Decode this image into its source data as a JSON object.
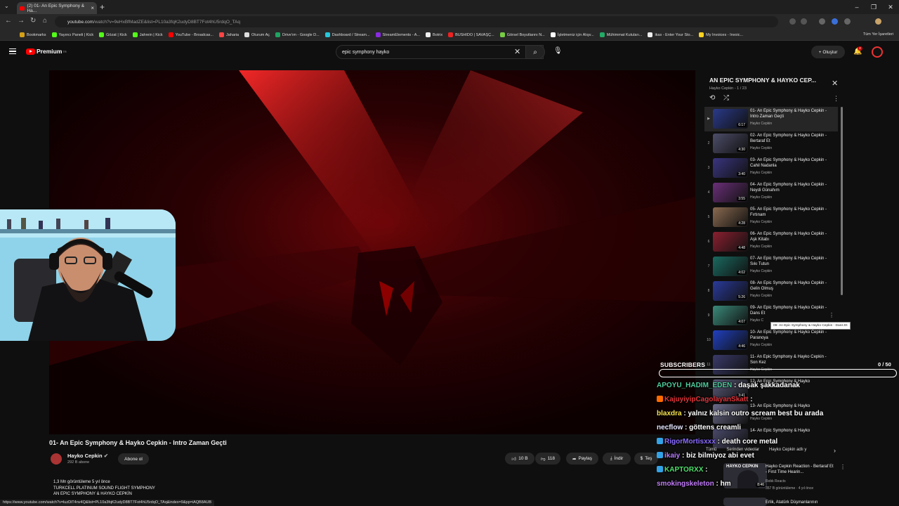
{
  "browser": {
    "tab_title": "(2) 01- An Epic Symphony & Ha...",
    "new_tab": "+",
    "url": "youtube.com",
    "url_rest": "/watch?v=9eHxBfMadZE&list=PL10a3fqK2udyD8BT7Fot4hU5rdqO_TAq",
    "bookmarks": [
      "Bookmarks",
      "Yayıncı Paneli | Kick",
      "Gözat | Kick",
      "Jahrein | Kick",
      "YouTube - Broadcas...",
      "Jaharia",
      "Oturum Aç",
      "Drive'ım - Google D...",
      "Dashboard / Stream...",
      "StreamElements - A...",
      "Botrix",
      "BUSHIDO | SAVAŞÇ...",
      "Görsel Boyutlarını N...",
      "İşletmeniz için Alışv...",
      "Mühimmat Kutuları...",
      "ikas - Enter Your Sto...",
      "My Invoices - Invoic..."
    ],
    "all_bookmarks": "Tüm Yer İşaretleri",
    "status_url": "https://www.youtube.com/watch?v=luzDiT4nv4Q&list=PL10a3fqK2udyD8BT7Fot4hU5rdqO_TAq&index=9&pp=iAQB8AUB"
  },
  "youtube": {
    "logo": "Premium",
    "logo_region": "TR",
    "search_value": "epic symphony hayko",
    "create_label": "Oluştur",
    "notif_count": "2"
  },
  "video": {
    "title": "01- An Epic Symphony & Hayko Cepkin - Intro Zaman Geçti",
    "channel": "Hayko Cepkin",
    "subscribers": "292 B abone",
    "subscribe_label": "Abone ol",
    "likes": "10 B",
    "comments": "118",
    "share": "Paylaş",
    "download": "İndir",
    "thanks": "Teş",
    "views_line": "1,3 Mn görüntüleme  5 yıl önce",
    "desc1": "TURKCELL PLATINUM SOUND FLIGHT SYMPHONY",
    "desc2": "AN EPIC SYMPHONY & HAYKO CEPKİN"
  },
  "playlist": {
    "title": "AN EPIC SYMPHONY & HAYKO CEP...",
    "sub": "Hayko Cepkin - 1 / 23",
    "tooltip": "09- An Epic Symphony & Hayko Cepkin - Dans Et",
    "items": [
      {
        "num": "▶",
        "title": "01- An Epic Symphony & Hayko Cepkin - Intro Zaman Geçti",
        "channel": "Hayko Cepkin",
        "duration": "6:17"
      },
      {
        "num": "2",
        "title": "02- An Epic Symphony & Hayko Cepkin - Bertaraf Et",
        "channel": "Hayko Cepkin",
        "duration": "4:30"
      },
      {
        "num": "3",
        "title": "03- An Epic Symphony & Hayko Cepkin - Cahil Nadanla",
        "channel": "Hayko Cepkin",
        "duration": "3:40"
      },
      {
        "num": "4",
        "title": "04- An Epic Symphony & Hayko Cepkin - Neydi Günahım",
        "channel": "Hayko Cepkin",
        "duration": "3:55"
      },
      {
        "num": "5",
        "title": "05- An Epic Symphony & Hayko Cepkin - Fırtınam",
        "channel": "Hayko Cepkin",
        "duration": "4:28"
      },
      {
        "num": "6",
        "title": "06- An Epic Symphony & Hayko Cepkin - Aşk Kitabı",
        "channel": "Hayko Cepkin",
        "duration": "4:48"
      },
      {
        "num": "7",
        "title": "07- An Epic Symphony & Hayko Cepkin - Sıkı Tutun",
        "channel": "Hayko Cepkin",
        "duration": "4:02"
      },
      {
        "num": "8",
        "title": "08- An Epic Symphony & Hayko Cepkin - Gelin Olmuş",
        "channel": "Hayko Cepkin",
        "duration": "5:26"
      },
      {
        "num": "9",
        "title": "09- An Epic Symphony & Hayko Cepkin - Dans Et",
        "channel": "Hayko C",
        "duration": "4:07"
      },
      {
        "num": "10",
        "title": "10- An Epic Symphony & Hayko Cepkin - Paranoya",
        "channel": "Hayko Cepkin",
        "duration": "4:46"
      },
      {
        "num": "11",
        "title": "11- An Epic Symphony & Hayko Cepkin - Son Kez",
        "channel": "Hayko Cepkin",
        "duration": ""
      },
      {
        "num": "",
        "title": "12- An Epic Symphony & Hayko",
        "channel": "",
        "duration": "3:41"
      },
      {
        "num": "",
        "title": "13- An Epic Symphony & Hayko",
        "channel": "Hayko Cepkin",
        "duration": ""
      },
      {
        "num": "",
        "title": "14- An Epic Symphony & Hayko",
        "channel": "",
        "duration": ""
      }
    ]
  },
  "chips": [
    "Tümü",
    "Serinden videolar",
    "Hayko Cepkin adlı y"
  ],
  "recommendation": {
    "title": "Hayko Cepkin Reaction - Bertaraf Et - First Time Hearin...",
    "channel": "Rebk Reacts",
    "meta": "357 B görüntüleme · 4 yıl önce",
    "duration": "8:46",
    "thumb_text": "HAYKO CEPKIN",
    "next_title": "Erlik, Atatürk Düşmanlarının"
  },
  "overlay": {
    "subs_label": "SUBSCRIBERS",
    "subs_count": "0 / 50",
    "messages": [
      {
        "user": "APOYU_HADIM_EDEN",
        "text": " : daşak şakkadanak",
        "color": "#4ecb9b",
        "icon": ""
      },
      {
        "user": "KajuyiyipCagolayanSkatt",
        "text": " :",
        "color": "#e0343a",
        "icon": "#ff6a00"
      },
      {
        "user": "blaxdra",
        "text": " : yalnız kalsin outro scream best bu arada",
        "color": "#f7e34d",
        "icon": ""
      },
      {
        "user": "necflow",
        "text": " : göttens creamli",
        "color": "#e6e6ff",
        "icon": ""
      },
      {
        "user": "RigorMortisxxx",
        "text": " : death core metal",
        "color": "#8a6bff",
        "icon": "#33a3e8"
      },
      {
        "user": "ikaiy",
        "text": " : biz bilmiyoz abi evet",
        "color": "#b97cff",
        "icon": "#33a3e8"
      },
      {
        "user": "KAPTORXX",
        "text": " :",
        "color": "#4ee06b",
        "icon": "#33a3e8"
      },
      {
        "user": "smokingskeleton",
        "text": " : hm",
        "color": "#c07cf7",
        "icon": ""
      }
    ]
  },
  "colors": {
    "accent": "#ff0000",
    "bg": "#0f0f0f"
  }
}
